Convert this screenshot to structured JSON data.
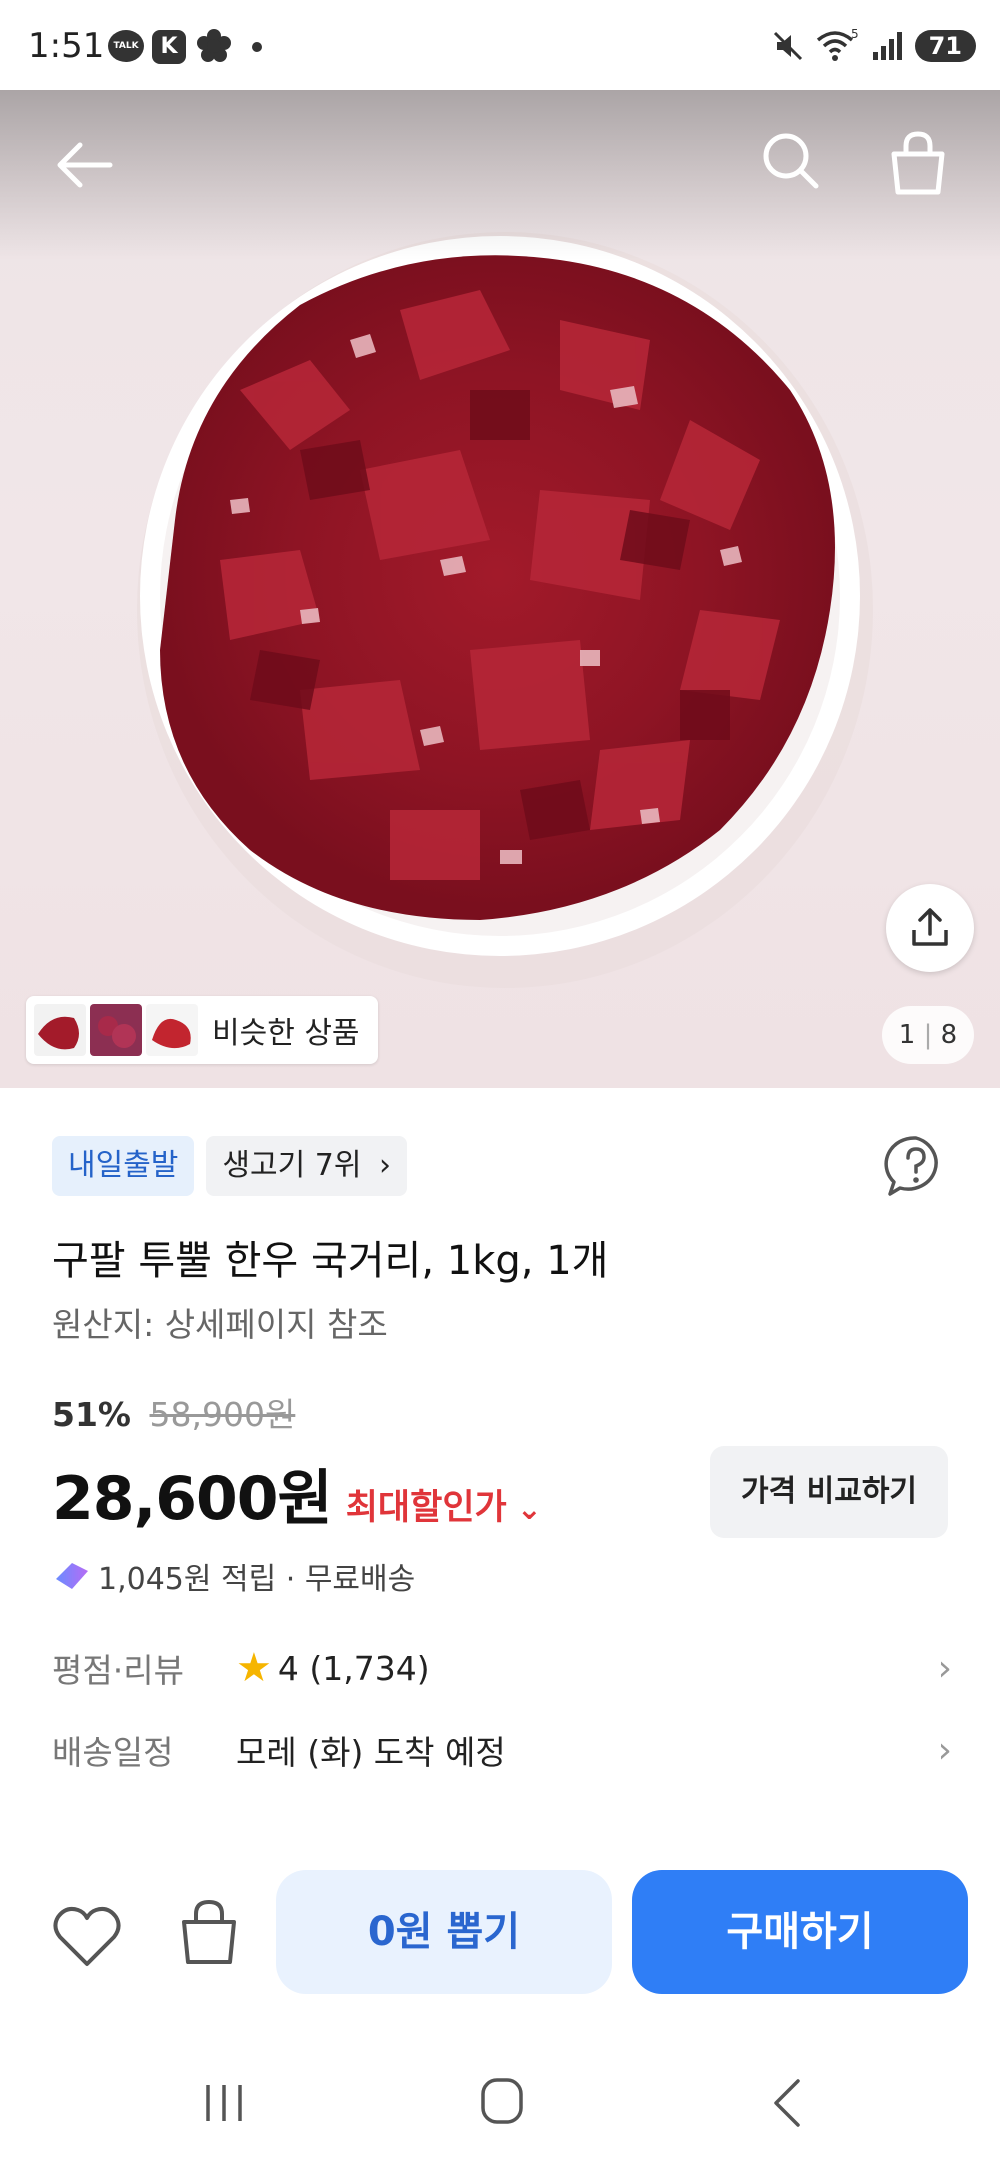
{
  "status_bar": {
    "time": "1:51",
    "talk_label": "TALK",
    "k_label": "K",
    "battery": "71",
    "wifi_label": "5"
  },
  "hero": {
    "similar_label": "비슷한 상품",
    "counter_current": "1",
    "counter_total": "8"
  },
  "product": {
    "badge_delivery": "내일출발",
    "badge_rank": "생고기 7위",
    "title": "구팔 투뿔 한우 국거리, 1kg, 1개",
    "origin": "원산지: 상세페이지 참조",
    "discount_pct": "51%",
    "original_price": "58,900원",
    "price": "28,600원",
    "max_discount": "최대할인가",
    "compare_label": "가격 비교하기",
    "points_text": "1,045원 적립 · 무료배송",
    "rating_label": "평점·리뷰",
    "rating_value": "4 (1,734)",
    "delivery_label": "배송일정",
    "delivery_value": "모레 (화) 도착 예정"
  },
  "actions": {
    "draw_label": "0원 뽑기",
    "buy_label": "구매하기"
  },
  "colors": {
    "primary_blue": "#2f7ef6",
    "sale_red": "#e0353a",
    "star_yellow": "#f6b500"
  }
}
